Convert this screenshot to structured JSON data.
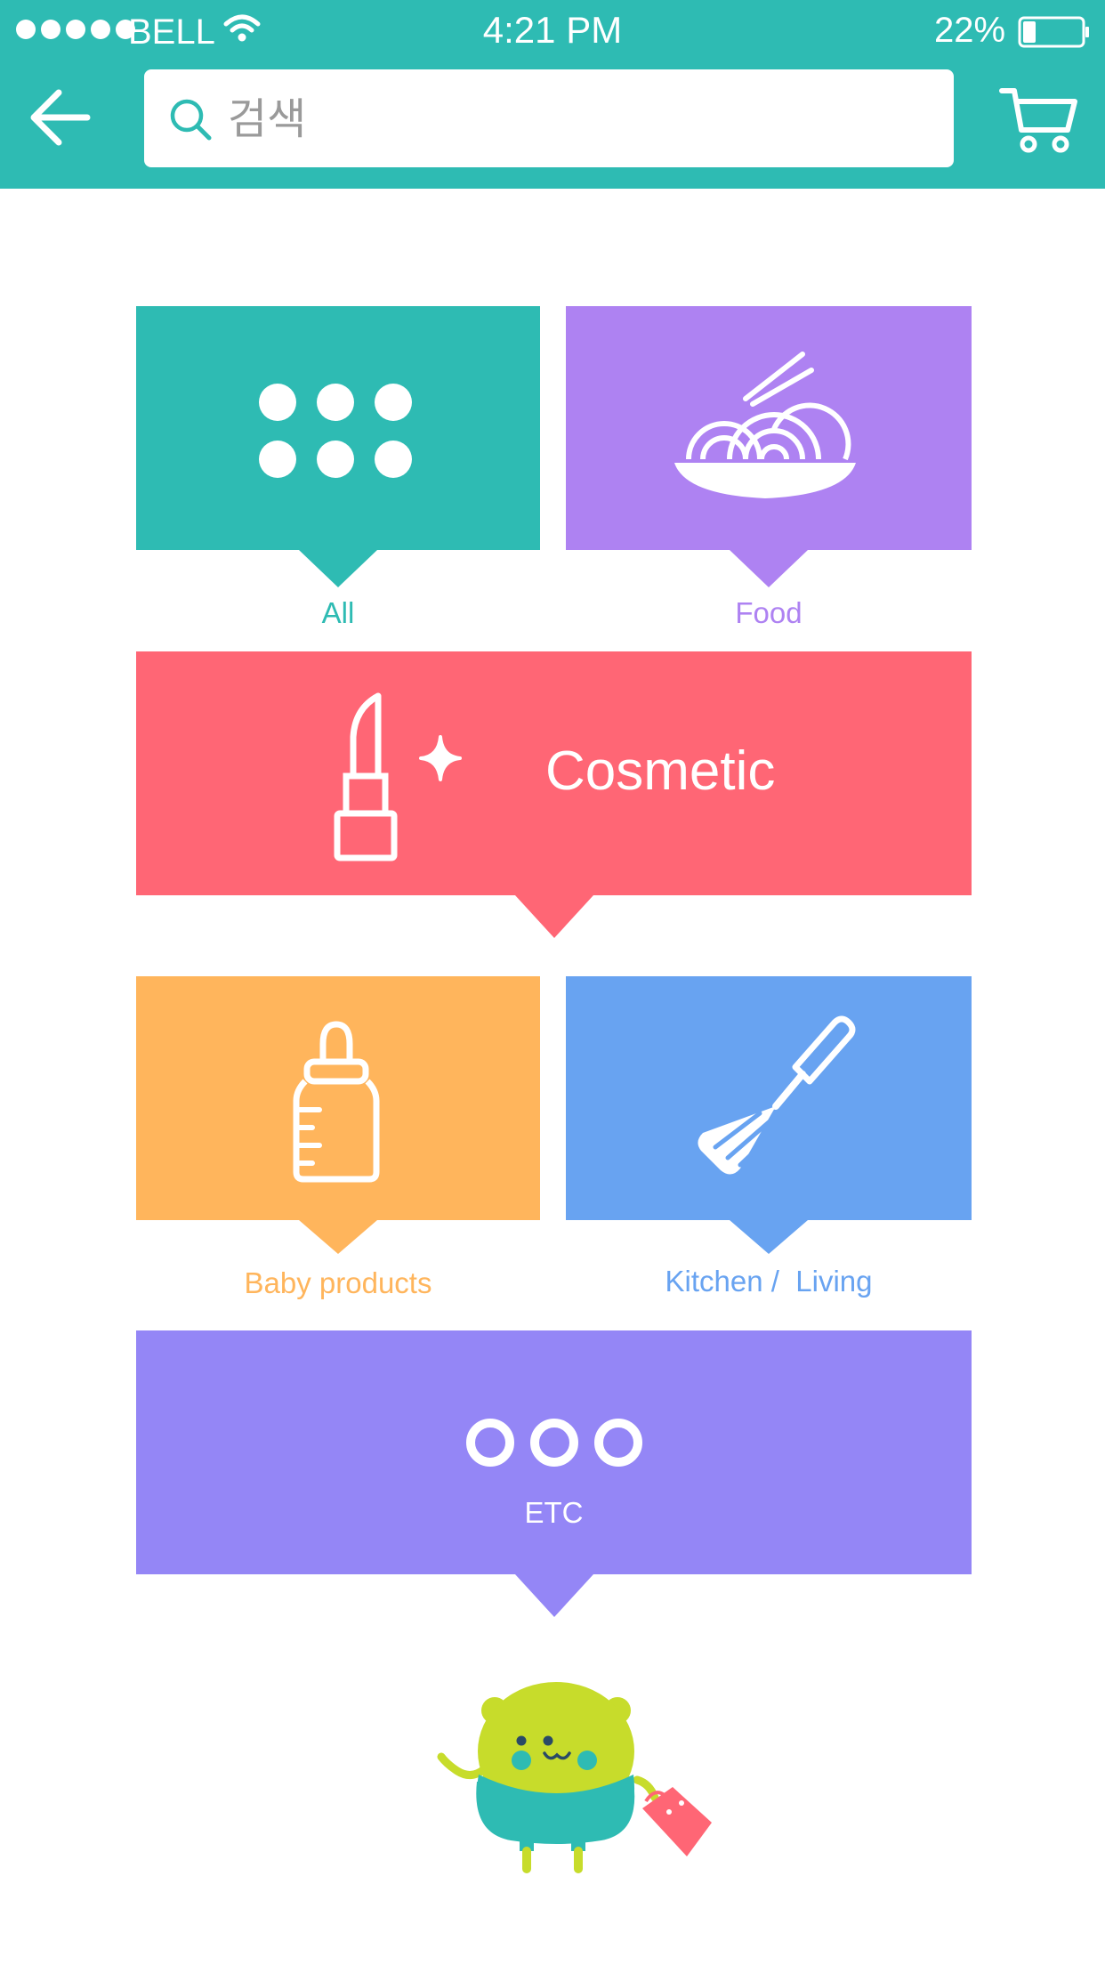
{
  "status_bar": {
    "carrier": "BELL",
    "time": "4:21 PM",
    "battery_percent": "22%",
    "battery_level": 0.22
  },
  "header": {
    "search_placeholder": "검색",
    "back_icon": "arrow-left-icon",
    "cart_icon": "shopping-cart-icon"
  },
  "colors": {
    "header_bg": "#2ebbb3",
    "all": "#2ebbb3",
    "food": "#ae82f2",
    "cosmetic": "#ff6675",
    "baby": "#ffb55c",
    "kitchen": "#68a3f1",
    "etc": "#9486f6"
  },
  "categories": {
    "all": {
      "label": "All",
      "icon": "six-dots-icon"
    },
    "food": {
      "label": "Food",
      "icon": "noodle-bowl-icon"
    },
    "cosmetic": {
      "label": "Cosmetic",
      "icon": "lipstick-icon"
    },
    "baby": {
      "label": "Baby products",
      "icon": "baby-bottle-icon"
    },
    "kitchen": {
      "label": "Kitchen /  Living",
      "icon": "spatula-icon"
    },
    "etc": {
      "label": "ETC",
      "icon": "three-circles-icon"
    }
  },
  "mascot": {
    "icon": "bear-mascot-with-shopping-bag"
  }
}
